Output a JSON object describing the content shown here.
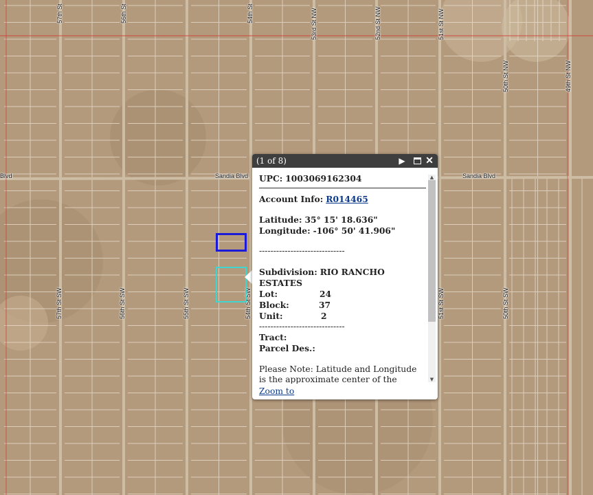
{
  "map": {
    "roads_vertical": [
      {
        "label": "57th St SW",
        "axis": "v"
      },
      {
        "label": "57th St"
      },
      {
        "label": "56th St"
      },
      {
        "label": "56th St SW"
      },
      {
        "label": "55th St SW"
      },
      {
        "label": "54th St"
      },
      {
        "label": "54th St SW"
      },
      {
        "label": "53rd St NW"
      },
      {
        "label": "52nd St NW"
      },
      {
        "label": "51st St NW"
      },
      {
        "label": "51st St SW"
      },
      {
        "label": "50th St NW"
      },
      {
        "label": "50th St SW"
      },
      {
        "label": "49th St NW"
      }
    ],
    "roads_horizontal": [
      {
        "label": "Sandia Blvd"
      },
      {
        "label": "Sandia Blvd"
      },
      {
        "label": "Blvd"
      }
    ],
    "colors": {
      "terrain": "#b49a7c",
      "grid": "#e8dccb",
      "road": "#cdbda5",
      "red_line": "#d0403a",
      "selected_parcel": "#1a1ad8",
      "highlight_parcel": "#3fd5d0"
    }
  },
  "popup": {
    "title": "(1 of 8)",
    "upc_label": "UPC:",
    "upc_value": "1003069162304",
    "account_label": "Account Info:",
    "account_value": "R014465",
    "lat_label": "Latitude:",
    "lat_value": "35° 15' 18.636\"",
    "lon_label": "Longitude:",
    "lon_value": "-106° 50' 41.906\"",
    "dash_line": "------------------------------",
    "subdivision_label": "Subdivision:",
    "subdivision_value": "RIO RANCHO",
    "subdivision_value2": "ESTATES",
    "lot_label": "Lot:",
    "lot_value": "24",
    "block_label": "Block:",
    "block_value": "37",
    "unit_label": "Unit:",
    "unit_value": "2",
    "tract_label": "Tract:",
    "parcel_label": "Parcel Des.:",
    "note": "Please Note: Latitude and Longitude is the approximate center of the parcel shown.",
    "zoom_label": "Zoom to",
    "icons": [
      "next-arrow-icon",
      "maximize-icon",
      "close-icon"
    ],
    "scroll_position": 0.0
  }
}
